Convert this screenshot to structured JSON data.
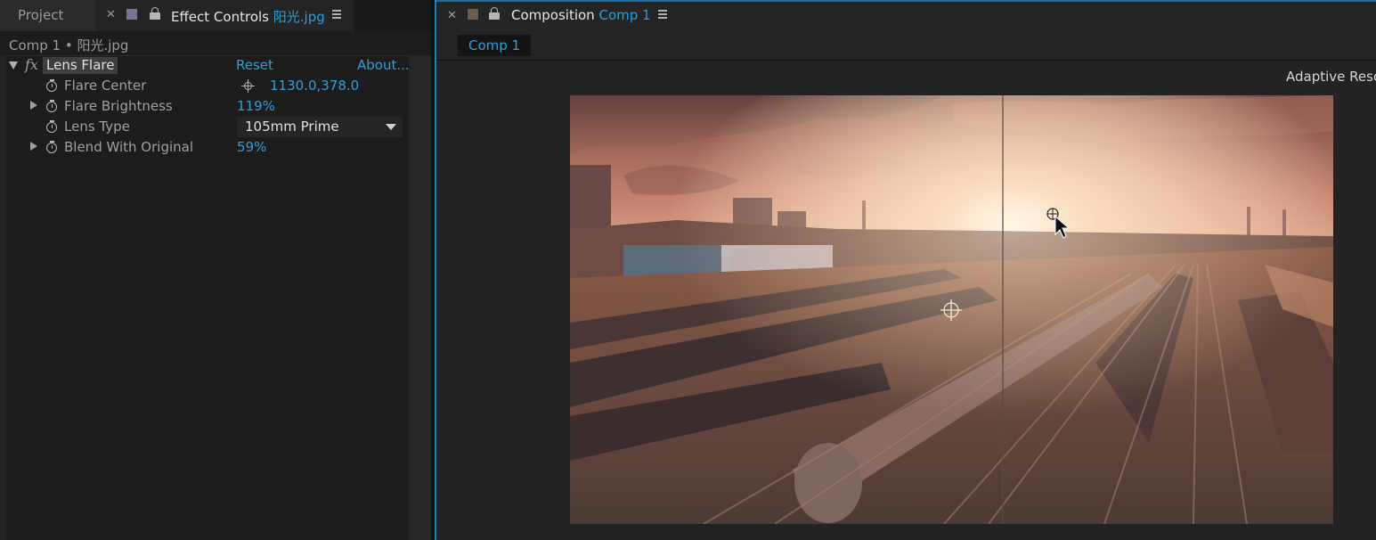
{
  "left_panel": {
    "project_tab": "Project",
    "effect_tab_prefix": "Effect Controls",
    "effect_tab_layer": "阳光.jpg",
    "subtitle": "Comp 1 • 阳光.jpg",
    "effect": {
      "name": "Lens Flare",
      "reset": "Reset",
      "about": "About...",
      "properties": [
        {
          "label": "Flare Center",
          "value": "1130.0,378.0"
        },
        {
          "label": "Flare Brightness",
          "value": "119%"
        },
        {
          "label": "Lens Type",
          "value": "105mm Prime"
        },
        {
          "label": "Blend With Original",
          "value": "59%"
        }
      ]
    }
  },
  "right_panel": {
    "tab_prefix": "Composition",
    "tab_comp": "Comp 1",
    "comp_button": "Comp 1",
    "adaptive": "Adaptive Reso"
  },
  "colors": {
    "accent": "#2d9fd9",
    "effect_swatch": "#7a7396",
    "comp_swatch": "#6b5c4d"
  }
}
